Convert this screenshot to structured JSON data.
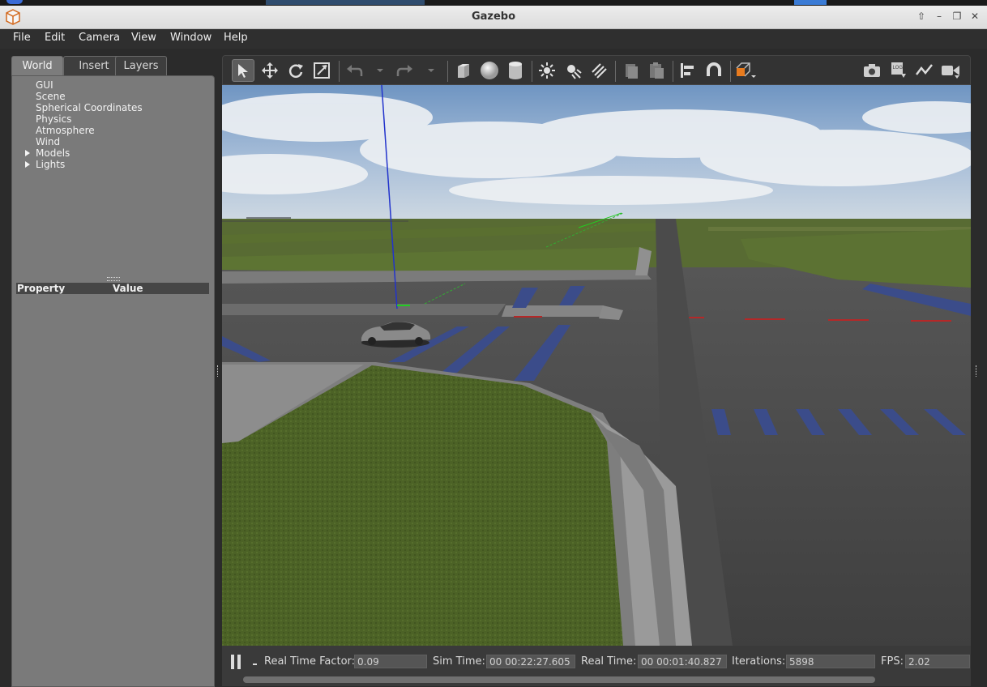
{
  "window": {
    "title": "Gazebo",
    "app_icon": "gazebo-logo-icon",
    "controls": [
      "maximize-up-icon",
      "minimize-icon",
      "restore-icon",
      "close-icon"
    ],
    "control_glyphs": [
      "⇧",
      "–",
      "❐",
      "✕"
    ]
  },
  "menu": {
    "items": [
      {
        "label": "File"
      },
      {
        "label": "Edit"
      },
      {
        "label": "Camera"
      },
      {
        "label": "View"
      },
      {
        "label": "Window"
      },
      {
        "label": "Help"
      }
    ]
  },
  "left_panel": {
    "tabs": [
      {
        "label": "World",
        "active": true
      },
      {
        "label": "Insert",
        "active": false
      },
      {
        "label": "Layers",
        "active": false
      }
    ],
    "tree": [
      {
        "label": "GUI",
        "expandable": false
      },
      {
        "label": "Scene",
        "expandable": false
      },
      {
        "label": "Spherical Coordinates",
        "expandable": false
      },
      {
        "label": "Physics",
        "expandable": false
      },
      {
        "label": "Atmosphere",
        "expandable": false
      },
      {
        "label": "Wind",
        "expandable": false
      },
      {
        "label": "Models",
        "expandable": true
      },
      {
        "label": "Lights",
        "expandable": true
      }
    ],
    "property_header": {
      "property": "Property",
      "value": "Value"
    }
  },
  "toolbar": {
    "left_tools": [
      "select-arrow-icon",
      "translate-icon",
      "rotate-icon",
      "scale-icon",
      "undo-icon",
      "undo-history-icon",
      "redo-icon",
      "redo-history-icon",
      "box-shape-icon",
      "sphere-shape-icon",
      "cylinder-shape-icon",
      "point-light-icon",
      "spot-light-icon",
      "directional-light-icon",
      "copy-icon",
      "paste-icon",
      "align-icon",
      "snap-magnet-icon",
      "view-angle-icon"
    ],
    "right_tools": [
      "screenshot-camera-icon",
      "log-record-icon",
      "plot-icon",
      "video-record-icon"
    ],
    "active_tool": "select-arrow-icon"
  },
  "viewport": {
    "description": "3D scene"
  },
  "status": {
    "real_time_factor_label": "Real Time Factor:",
    "real_time_factor": "0.09",
    "sim_time_label": "Sim Time:",
    "sim_time": "00 00:22:27.605",
    "real_time_label": "Real Time:",
    "real_time": "00 00:01:40.827",
    "iterations_label": "Iterations:",
    "iterations": "5898",
    "fps_label": "FPS:",
    "fps": "2.02",
    "step_label": "-"
  }
}
